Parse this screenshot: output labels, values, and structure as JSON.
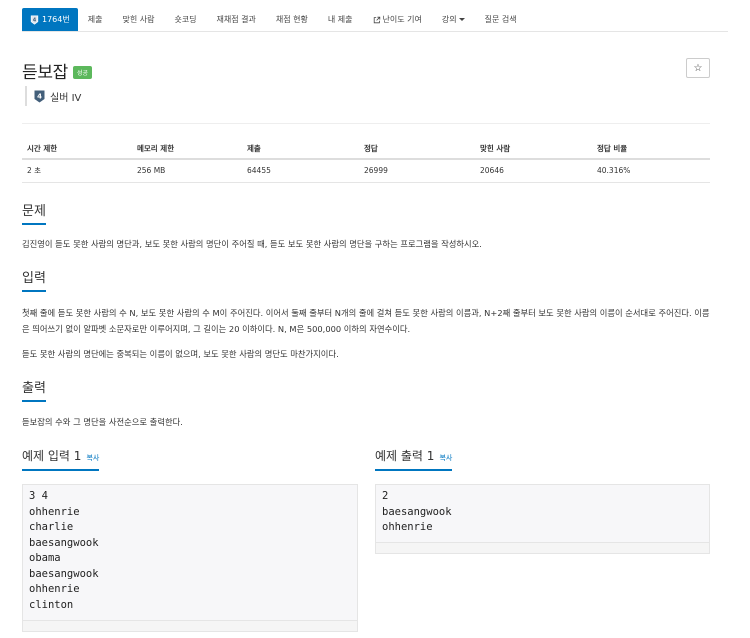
{
  "nav": {
    "problem_number": "1764번",
    "submit": "제출",
    "solved_users": "맞힌 사람",
    "shortest": "숏코딩",
    "rejudge": "재채점 결과",
    "status": "채점 현황",
    "my_submissions": "내 제출",
    "difficulty": "난이도 기여",
    "lectures": "강의",
    "questions": "질문 검색"
  },
  "problem": {
    "title": "듣보잡",
    "badge": "성공",
    "tier": "실버 IV",
    "tier_level": "4",
    "star": "☆"
  },
  "info_table": {
    "headers": [
      "시간 제한",
      "메모리 제한",
      "제출",
      "정답",
      "맞힌 사람",
      "정답 비율"
    ],
    "values": [
      "2 초",
      "256 MB",
      "64455",
      "26999",
      "20646",
      "40.316%"
    ]
  },
  "sections": {
    "problem_title": "문제",
    "problem_text": "김진영이 듣도 못한 사람의 명단과, 보도 못한 사람의 명단이 주어질 때, 듣도 보도 못한 사람의 명단을 구하는 프로그램을 작성하시오.",
    "input_title": "입력",
    "input_text_1": "첫째 줄에 듣도 못한 사람의 수 N, 보도 못한 사람의 수 M이 주어진다. 이어서 둘째 줄부터 N개의 줄에 걸쳐 듣도 못한 사람의 이름과, N+2째 줄부터 보도 못한 사람의 이름이 순서대로 주어진다. 이름은 띄어쓰기 없이 알파벳 소문자로만 이루어지며, 그 길이는 20 이하이다. N, M은 500,000 이하의 자연수이다.",
    "input_text_2": "듣도 못한 사람의 명단에는 중복되는 이름이 없으며, 보도 못한 사람의 명단도 마찬가지이다.",
    "output_title": "출력",
    "output_text": "듣보잡의 수와 그 명단을 사전순으로 출력한다."
  },
  "samples": {
    "input_title": "예제 입력 1",
    "output_title": "예제 출력 1",
    "copy_label": "복사",
    "input_lines": [
      "3 4",
      "ohhenrie",
      "charlie",
      "baesangwook",
      "obama",
      "baesangwook",
      "ohhenrie",
      "clinton"
    ],
    "output_lines": [
      "2",
      "baesangwook",
      "ohhenrie"
    ]
  },
  "colors": {
    "accent": "#0076c0",
    "success": "#5cb85c"
  }
}
